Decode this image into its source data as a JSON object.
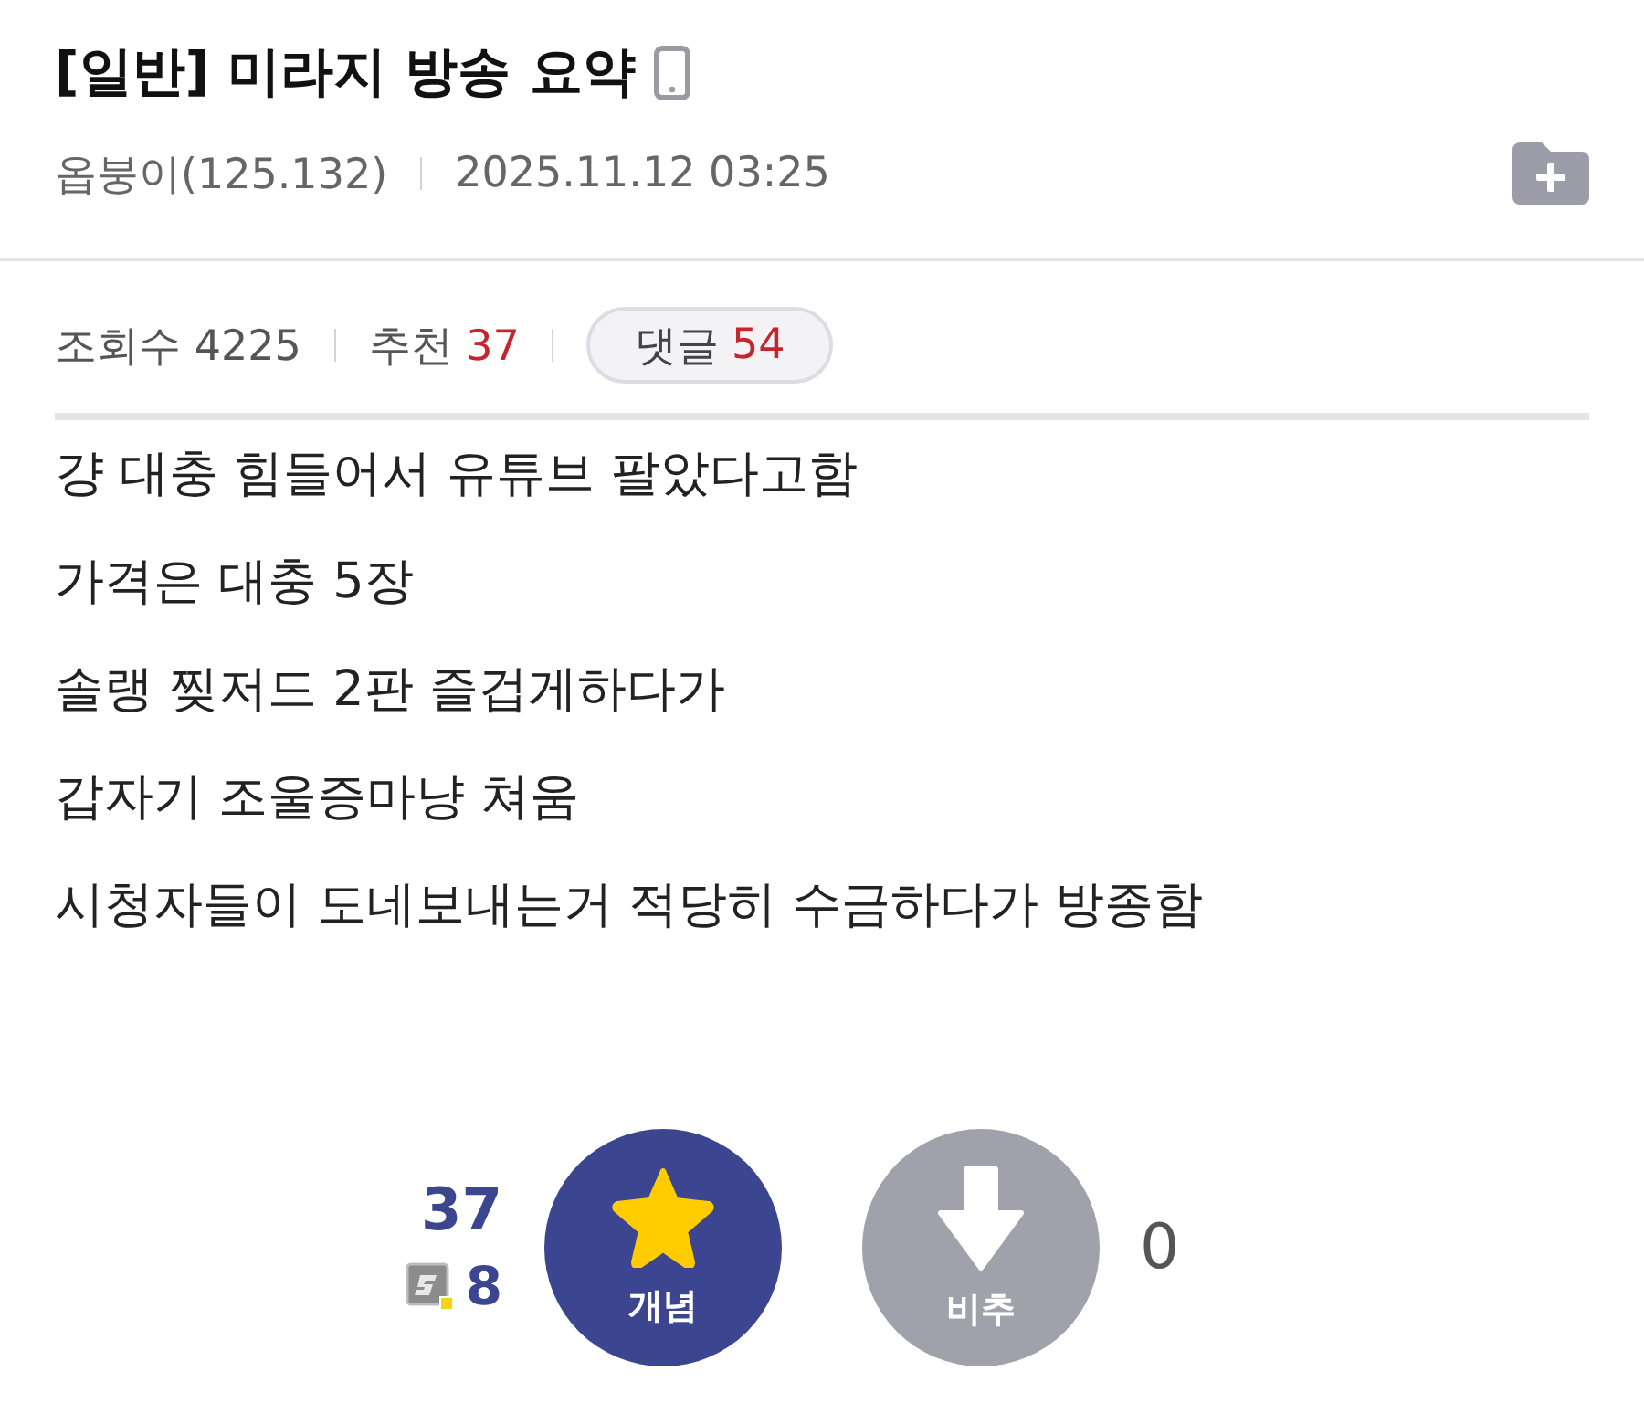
{
  "post": {
    "title": "[일반] 미라지 방송 요약",
    "author": "옵붕이(125.132)",
    "date": "2025.11.12 03:25"
  },
  "stats": {
    "views_label": "조회수",
    "views": "4225",
    "recommend_label": "추천",
    "recommend": "37",
    "comments_label": "댓글",
    "comments": "54"
  },
  "body": {
    "lines": [
      "걍 대충 힘들어서 유튜브 팔았다고함",
      "가격은 대충 5장",
      "솔랭 찢저드 2판 즐겁게하다가",
      "갑자기 조울증마냥 쳐움",
      "시청자들이 도네보내는거 적당히 수금하다가 방종함"
    ]
  },
  "votes": {
    "up_count": "37",
    "fixed_count": "8",
    "up_label": "개념",
    "down_label": "비추",
    "down_count": "0"
  }
}
